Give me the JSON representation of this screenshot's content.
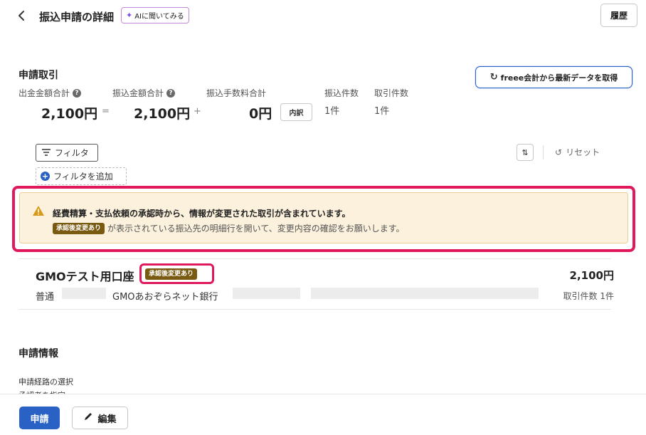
{
  "header": {
    "back_icon": "chevron-left-icon",
    "title": "振込申請の詳細",
    "ai_label": "AIに聞いてみる",
    "history_label": "履歴"
  },
  "transactions": {
    "title": "申請取引",
    "refresh_label": "freee会計から最新データを取得",
    "stats": {
      "outgoing_label": "出金金額合計",
      "outgoing_value": "2,100円",
      "equals": "=",
      "transfer_label": "振込金額合計",
      "transfer_value": "2,100円",
      "plus": "+",
      "fee_label": "振込手数料合計",
      "fee_value": "0円",
      "breakdown_label": "内訳",
      "transfer_count_label": "振込件数",
      "transfer_count_value": "1件",
      "txn_count_label": "取引件数",
      "txn_count_value": "1件"
    },
    "filter_label": "フィルタ",
    "add_filter_label": "フィルタを追加",
    "reset_label": "リセット"
  },
  "alert": {
    "title": "経費精算・支払依頼の承認時から、情報が変更された取引が含まれています。",
    "badge": "承認後変更あり",
    "message": "が表示されている振込先の明細行を開いて、変更内容の確認をお願いします。",
    "accent": "#e0185c",
    "background": "#fcf1dc"
  },
  "account": {
    "name": "GMOテスト用口座",
    "badge": "承認後変更あり",
    "amount": "2,100円",
    "type": "普通",
    "bank": "GMOあおぞらネット銀行",
    "count": "取引件数 1件"
  },
  "info": {
    "title": "申請情報",
    "route_label": "申請経路の選択",
    "next_label": "承認者を指定"
  },
  "footer": {
    "submit_label": "申請",
    "edit_label": "編集"
  },
  "colors": {
    "primary": "#2a61c5",
    "badge": "#7a5a10"
  }
}
